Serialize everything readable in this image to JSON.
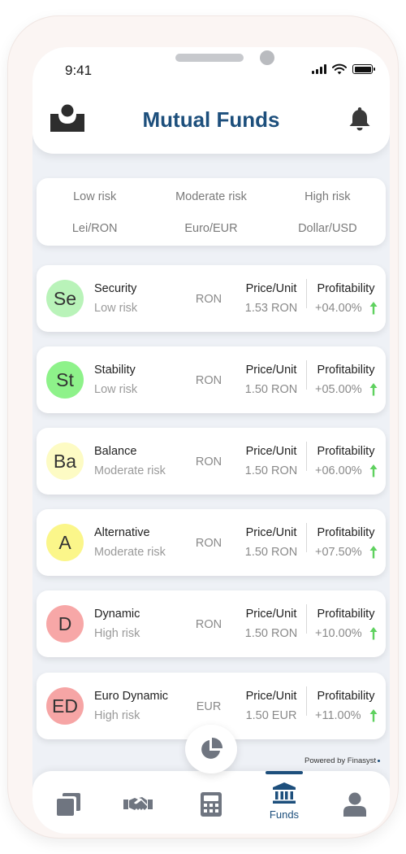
{
  "status_bar": {
    "time": "9:41"
  },
  "header": {
    "title": "Mutual Funds"
  },
  "filters": {
    "risk": [
      "Low risk",
      "Moderate risk",
      "High risk"
    ],
    "currency": [
      "Lei/RON",
      "Euro/EUR",
      "Dollar/USD"
    ]
  },
  "funds": [
    {
      "initials": "Se",
      "name": "Security",
      "risk": "Low risk",
      "currency": "RON",
      "price_label": "Price/Unit",
      "price": "1.53 RON",
      "profit_label": "Profitability",
      "profit": "+04.00%",
      "avatar_color": "#b9f3b9"
    },
    {
      "initials": "St",
      "name": "Stability",
      "risk": "Low risk",
      "currency": "RON",
      "price_label": "Price/Unit",
      "price": "1.50 RON",
      "profit_label": "Profitability",
      "profit": "+05.00%",
      "avatar_color": "#8ef28a"
    },
    {
      "initials": "Ba",
      "name": "Balance",
      "risk": "Moderate risk",
      "currency": "RON",
      "price_label": "Price/Unit",
      "price": "1.50 RON",
      "profit_label": "Profitability",
      "profit": "+06.00%",
      "avatar_color": "#fdfbc4"
    },
    {
      "initials": "A",
      "name": "Alternative",
      "risk": "Moderate risk",
      "currency": "RON",
      "price_label": "Price/Unit",
      "price": "1.50 RON",
      "profit_label": "Profitability",
      "profit": "+07.50%",
      "avatar_color": "#fbf68a"
    },
    {
      "initials": "D",
      "name": "Dynamic",
      "risk": "High risk",
      "currency": "RON",
      "price_label": "Price/Unit",
      "price": "1.50 RON",
      "profit_label": "Profitability",
      "profit": "+10.00%",
      "avatar_color": "#f7a7a7"
    },
    {
      "initials": "ED",
      "name": "Euro Dynamic",
      "risk": "High risk",
      "currency": "EUR",
      "price_label": "Price/Unit",
      "price": "1.50 EUR",
      "profit_label": "Profitability",
      "profit": "+11.00%",
      "avatar_color": "#f6a5a5"
    }
  ],
  "footer": {
    "powered_by": "Powered by Finasyst"
  },
  "bottom_nav": {
    "items": [
      {
        "icon": "cards-icon"
      },
      {
        "icon": "handshake-icon"
      },
      {
        "icon": "calculator-icon"
      },
      {
        "icon": "bank-icon",
        "label": "Funds",
        "active": true
      },
      {
        "icon": "user-icon"
      }
    ]
  },
  "colors": {
    "accent": "#1d4f7c",
    "profit_up": "#5fd15f",
    "icon_gray": "#6f7580"
  }
}
